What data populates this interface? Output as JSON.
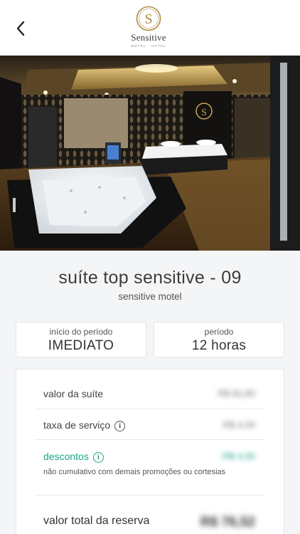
{
  "header": {
    "back_icon": "chevron-left-icon",
    "logo": {
      "letter": "S",
      "word": "Sensitive",
      "sub": "MOTEL · HOTEL"
    }
  },
  "gallery": {
    "image": "motel-suite-photo",
    "wall_logo_letter": "S",
    "page_count": 13,
    "active_index": 0
  },
  "suite": {
    "name": "suíte top sensitive - 09",
    "motel": "sensitive motel"
  },
  "booking": {
    "start": {
      "label": "início do período",
      "value": "IMEDIATO"
    },
    "period": {
      "label": "período",
      "value": "12 horas"
    }
  },
  "pricing": {
    "suite_value": {
      "label": "valor da suíte",
      "value": "R$ 82,80"
    },
    "service_fee": {
      "label": "taxa de serviço",
      "value": "R$ 4,00"
    },
    "discounts": {
      "label": "descontos",
      "value": "-R$ 4,00",
      "note": "não cumulativo com demais promoções ou cortesias"
    },
    "total": {
      "label": "valor total da reserva",
      "value": "R$ 76,52"
    }
  },
  "colors": {
    "accent_green": "#19a486",
    "gold": "#b08a3e"
  }
}
